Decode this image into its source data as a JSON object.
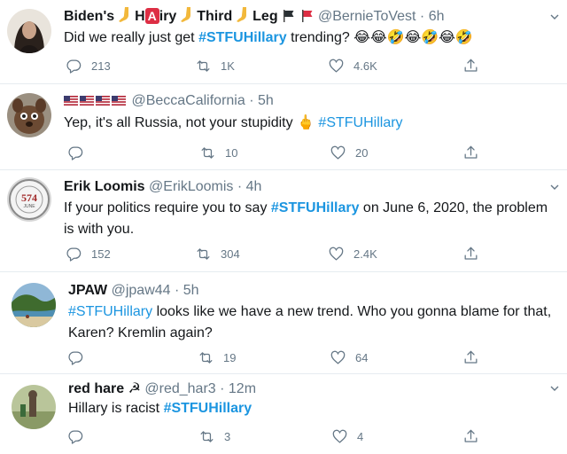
{
  "tweets": [
    {
      "name_parts": [
        "Biden's",
        "H",
        "A",
        "iry",
        "Third",
        "Leg"
      ],
      "handle": "@BernieToVest",
      "time": "6h",
      "text_before": "Did we really just get ",
      "hashtag": "#STFUHillary",
      "text_after": " trending? ",
      "emoji": "😂😂🤣😂🤣😂🤣",
      "reply": "213",
      "retweet": "1K",
      "like": "4.6K"
    },
    {
      "handle": "@BeccaCalifornia",
      "time": "5h",
      "text_before": "Yep, it's all Russia, not your stupidity ",
      "emoji": "🖕",
      "hashtag": "#STFUHillary",
      "reply": "",
      "retweet": "10",
      "like": "20"
    },
    {
      "name": "Erik Loomis",
      "handle": "@ErikLoomis",
      "time": "4h",
      "avatar_text": "574",
      "avatar_sub": "JUNE",
      "text_before": "If your politics require you to say ",
      "hashtag": "#STFUHillary",
      "text_after": " on June 6, 2020, the problem is with you.",
      "reply": "152",
      "retweet": "304",
      "like": "2.4K"
    },
    {
      "name": "JPAW",
      "handle": "@jpaw44",
      "time": "5h",
      "hashtag": "#STFUHillary",
      "text_after": " looks like we have a new trend. Who you gonna blame for that, Karen? Kremlin again?",
      "reply": "",
      "retweet": "19",
      "like": "64"
    },
    {
      "name": "red hare",
      "name_symbol": "☭",
      "handle": "@red_har3",
      "time": "12m",
      "text_before": "Hillary is racist ",
      "hashtag": "#STFUHillary",
      "reply": "",
      "retweet": "3",
      "like": "4"
    }
  ],
  "icons": {
    "reply": "reply-icon",
    "retweet": "retweet-icon",
    "like": "heart-icon",
    "share": "share-icon",
    "more": "chevron-down-icon"
  },
  "colors": {
    "link": "#1b95e0",
    "secondary": "#657786",
    "divider": "#e6ecf0"
  }
}
